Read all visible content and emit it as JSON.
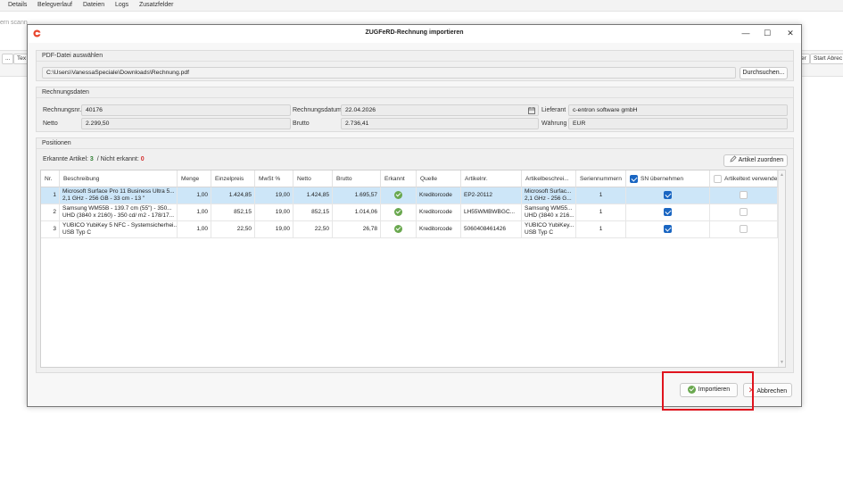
{
  "background": {
    "menu": [
      "Details",
      "Belegverlauf",
      "Dateien",
      "Logs",
      "Zusatzfelder"
    ],
    "search_fragment": "ern scann",
    "toolbar_left": [
      "...",
      "Tex"
    ],
    "toolbar_right": [
      "er",
      "Start Abrec"
    ]
  },
  "dialog": {
    "title": "ZUGFeRD-Rechnung importieren",
    "window_buttons": {
      "minimize": "—",
      "maximize": "☐",
      "close": "✕"
    },
    "pdf": {
      "group_title": "PDF-Datei auswählen",
      "path": "C:\\Users\\VanessaSpeciale\\Downloads\\Rechnung.pdf",
      "browse_label": "Durchsuchen..."
    },
    "invoice": {
      "group_title": "Rechnungsdaten",
      "rechnungsnr_label": "Rechnungsnr.",
      "rechnungsnr": "40176",
      "rechnungsdatum_label": "Rechnungsdatum",
      "rechnungsdatum": "22.04.2026",
      "lieferant_label": "Lieferant",
      "lieferant": "c-entron software gmbH",
      "netto_label": "Netto",
      "netto": "2.299,50",
      "brutto_label": "Brutto",
      "brutto": "2.736,41",
      "waehrung_label": "Währung",
      "waehrung": "EUR"
    },
    "positions": {
      "group_title": "Positionen",
      "recognized_label": "Erkannte Artikel:",
      "recognized_count": "3",
      "not_recognized_label": "/ Nicht erkannt:",
      "not_recognized_count": "0",
      "assign_button": "Artikel zuordnen",
      "columns": [
        "Nr.",
        "Beschreibung",
        "Menge",
        "Einzelpreis",
        "MwSt %",
        "Netto",
        "Brutto",
        "Erkannt",
        "Quelle",
        "Artikelnr.",
        "Artikelbeschrei...",
        "Seriennummern",
        "SN übernehmen",
        "Artikeltext verwenden"
      ],
      "header_sn_checked": true,
      "header_text_checked": false,
      "rows": [
        {
          "nr": "1",
          "desc1": "Microsoft Surface Pro 11 Business Ultra 5...",
          "desc2": "2,1 GHz - 256 GB - 33 cm - 13 \"",
          "menge": "1,00",
          "einzelpreis": "1.424,85",
          "mwst": "19,00",
          "netto": "1.424,85",
          "brutto": "1.695,57",
          "erkannt": true,
          "quelle": "Kreditorcode",
          "artikelnr": "EP2-20112",
          "artdesc1": "Microsoft Surfac...",
          "artdesc2": "2,1 GHz - 256 G...",
          "serien": "1",
          "sn": true,
          "text": false,
          "selected": true
        },
        {
          "nr": "2",
          "desc1": "Samsung WM55B - 139.7 cm (55\") - 350...",
          "desc2": "UHD (3840 x 2160) - 350 cd/ m2 - 178/17...",
          "menge": "1,00",
          "einzelpreis": "852,15",
          "mwst": "19,00",
          "netto": "852,15",
          "brutto": "1.014,06",
          "erkannt": true,
          "quelle": "Kreditorcode",
          "artikelnr": "LH55WMBWBGC...",
          "artdesc1": "Samsung WM55...",
          "artdesc2": "UHD (3840 x 216...",
          "serien": "1",
          "sn": true,
          "text": false,
          "selected": false
        },
        {
          "nr": "3",
          "desc1": "YUBICO YubiKey 5 NFC - Systemsicherhei...",
          "desc2": "USB Typ C",
          "menge": "1,00",
          "einzelpreis": "22,50",
          "mwst": "19,00",
          "netto": "22,50",
          "brutto": "26,78",
          "erkannt": true,
          "quelle": "Kreditorcode",
          "artikelnr": "5060408461426",
          "artdesc1": "YUBICO YubiKey...",
          "artdesc2": "USB Typ C",
          "serien": "1",
          "sn": true,
          "text": false,
          "selected": false
        }
      ]
    },
    "footer": {
      "import_label": "Importieren",
      "cancel_label": "Abbrechen"
    },
    "colors": {
      "accent": "#1a66c2",
      "selected_row": "#cde6f8",
      "recognized": "#6aa84f",
      "highlight": "#e0141e",
      "count_ok": "#2e7d32",
      "count_bad": "#d32f2f"
    }
  }
}
